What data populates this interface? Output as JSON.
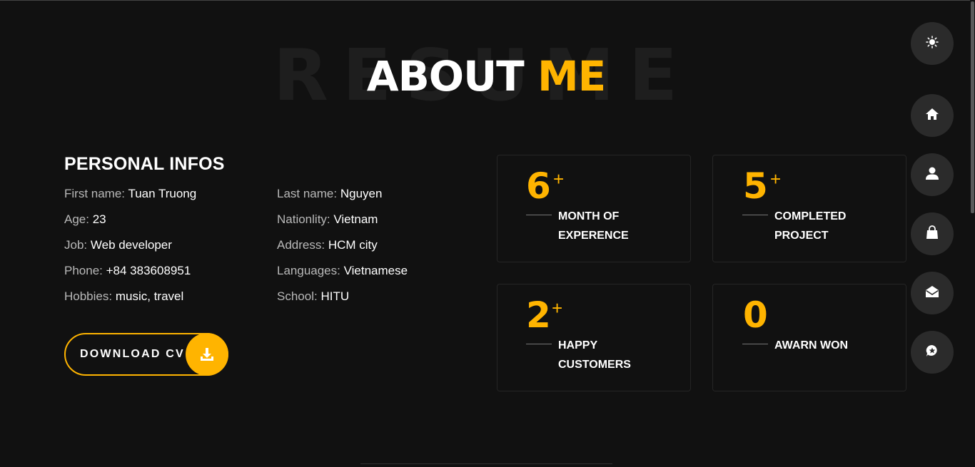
{
  "title": {
    "background_word": "RESUME",
    "main": "ABOUT",
    "accent": "ME"
  },
  "colors": {
    "accent": "#ffb400",
    "background": "#111111",
    "card_border": "#252525",
    "nav_bg": "#2b2b2b"
  },
  "personal": {
    "heading": "PERSONAL INFOS",
    "left": [
      {
        "key": "First name:",
        "value": "Tuan Truong"
      },
      {
        "key": "Age:",
        "value": "23"
      },
      {
        "key": "Job:",
        "value": "Web developer"
      },
      {
        "key": "Phone:",
        "value": "+84 383608951"
      },
      {
        "key": "Hobbies:",
        "value": "music, travel"
      }
    ],
    "right": [
      {
        "key": "Last name:",
        "value": "Nguyen"
      },
      {
        "key": "Nationlity:",
        "value": "Vietnam"
      },
      {
        "key": "Address:",
        "value": "HCM city"
      },
      {
        "key": "Languages:",
        "value": "Vietnamese"
      },
      {
        "key": "School:",
        "value": "HITU"
      }
    ]
  },
  "download": {
    "label": "DOWNLOAD CV",
    "icon": "download-icon"
  },
  "stats": [
    {
      "number": "6",
      "plus": "+",
      "line1": "MONTH OF",
      "line2": "EXPERENCE"
    },
    {
      "number": "5",
      "plus": "+",
      "line1": "COMPLETED",
      "line2": "PROJECT"
    },
    {
      "number": "2",
      "plus": "+",
      "line1": "HAPPY",
      "line2": "CUSTOMERS"
    },
    {
      "number": "0",
      "plus": "",
      "line1": "AWARN WON",
      "line2": ""
    }
  ],
  "nav": [
    {
      "icon": "sun-icon"
    },
    {
      "icon": "home-icon"
    },
    {
      "icon": "user-icon"
    },
    {
      "icon": "shopping-bag-icon"
    },
    {
      "icon": "envelope-open-icon"
    },
    {
      "icon": "chat-star-icon"
    }
  ]
}
